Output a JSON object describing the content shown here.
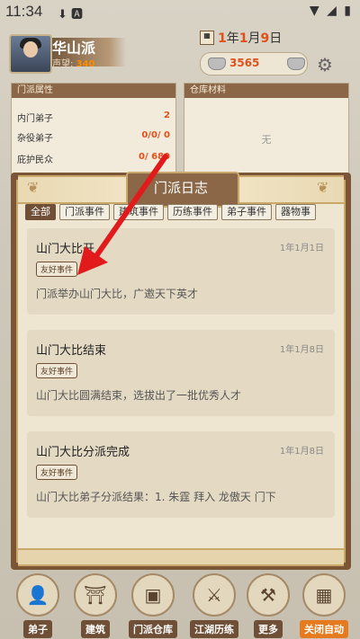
{
  "status_bar": {
    "time": "11:34",
    "left_icons": "⬇ 🅰",
    "right_icons": "▼ ◢ ▮"
  },
  "header": {
    "sect_name": "华山派",
    "prestige_label": "声望:",
    "prestige_value": "340",
    "date": {
      "y": "1",
      "y_unit": "年",
      "m": "1",
      "m_unit": "月",
      "d": "9",
      "d_unit": "日"
    },
    "silver": "3565"
  },
  "panels": {
    "sect_attributes": {
      "title": "门派属性",
      "rows": [
        {
          "label": "内门弟子",
          "value": "2"
        },
        {
          "label": "杂役弟子",
          "value": "0/0/ 0"
        },
        {
          "label": "庇护民众",
          "value": "0/ 680"
        }
      ]
    },
    "warehouse": {
      "title": "仓库材料",
      "empty": "无"
    }
  },
  "modal": {
    "title": "门派日志",
    "tabs": [
      "全部",
      "门派事件",
      "建筑事件",
      "历练事件",
      "弟子事件",
      "器物事"
    ],
    "active_tab": 0,
    "events": [
      {
        "title": "山门大比开",
        "date": "1年1月1日",
        "badge": "友好事件",
        "desc": "门派举办山门大比，广邀天下英才"
      },
      {
        "title": "山门大比结束",
        "date": "1年1月8日",
        "badge": "友好事件",
        "desc": "山门大比圆满结束，选拔出了一批优秀人才"
      },
      {
        "title": "山门大比分派完成",
        "date": "1年1月8日",
        "badge": "友好事件",
        "desc": "山门大比弟子分派结果：1. 朱霆 拜入 龙傲天 门下"
      }
    ]
  },
  "nav": [
    {
      "label": "弟子",
      "icon": "disciple-icon",
      "glyph": "👤"
    },
    {
      "label": "建筑",
      "icon": "building-icon",
      "glyph": "⛩"
    },
    {
      "label": "门派仓库",
      "icon": "chest-icon",
      "glyph": "▣"
    },
    {
      "label": "江湖历练",
      "icon": "warrior-icon",
      "glyph": "⚔"
    },
    {
      "label": "更多",
      "icon": "hammer-icon",
      "glyph": "⚒"
    },
    {
      "label": "关闭自动",
      "icon": "calendar-icon",
      "glyph": "▦"
    }
  ],
  "colors": {
    "accent_orange": "#e0501a",
    "arrow_red": "#e11b1b",
    "brown": "#6f4f36"
  }
}
